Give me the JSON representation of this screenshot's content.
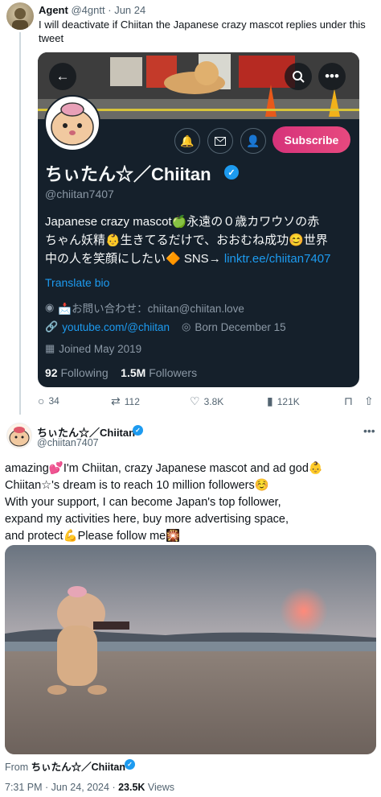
{
  "tweet1": {
    "name": "Agent",
    "handle": "@4gntt",
    "separator": "·",
    "date": "Jun 24",
    "text": "I will deactivate if Chiitan the Japanese crazy mascot replies under this tweet"
  },
  "profile_card": {
    "back_icon": "arrow-left-icon",
    "subscribe_label": "Subscribe",
    "name": "ちぃたん☆／Chiitan",
    "handle": "@chiitan7407",
    "bio_line1": "Japanese crazy mascot🍏永遠の０歳カワウソの赤",
    "bio_line2": "ちゃん妖精👶生きてるだけで、おおむね成功😊世界",
    "bio_line3_prefix": "中の人を笑顔にしたい🔶 SNS→ ",
    "bio_link": "linktr.ee/chiitan7407",
    "translate_label": "Translate bio",
    "location": "📩お問い合わせ：chiitan@chiitan.love",
    "website": "youtube.com/@chiitan",
    "born": "Born December 15",
    "joined": "Joined May 2019",
    "following_count": "92",
    "following_label": "Following",
    "followers_count": "1.5M",
    "followers_label": "Followers"
  },
  "tweet1_actions": {
    "replies": "34",
    "retweets": "112",
    "likes": "3.8K",
    "views": "121K"
  },
  "tweet2": {
    "name": "ちぃたん☆／Chiitan",
    "handle": "@chiitan7407",
    "line1": "amazing💕I'm Chiitan, crazy Japanese mascot and ad god👶",
    "line2": "Chiitan☆'s dream is to reach 10 million followers☺️",
    "line3": "With your support, I can become Japan's top follower,",
    "line4": "expand my activities here, buy more advertising space,",
    "line5": "and protect💪Please follow me🎇",
    "from_label": "From",
    "from_name": "ちぃたん☆／Chiitan",
    "time": "7:31 PM",
    "date": "Jun 24, 2024",
    "views_count": "23.5K",
    "views_label": "Views"
  },
  "colors": {
    "accent": "#1d9bf0",
    "card_bg": "#15202b",
    "subscribe": "#d6337a"
  }
}
